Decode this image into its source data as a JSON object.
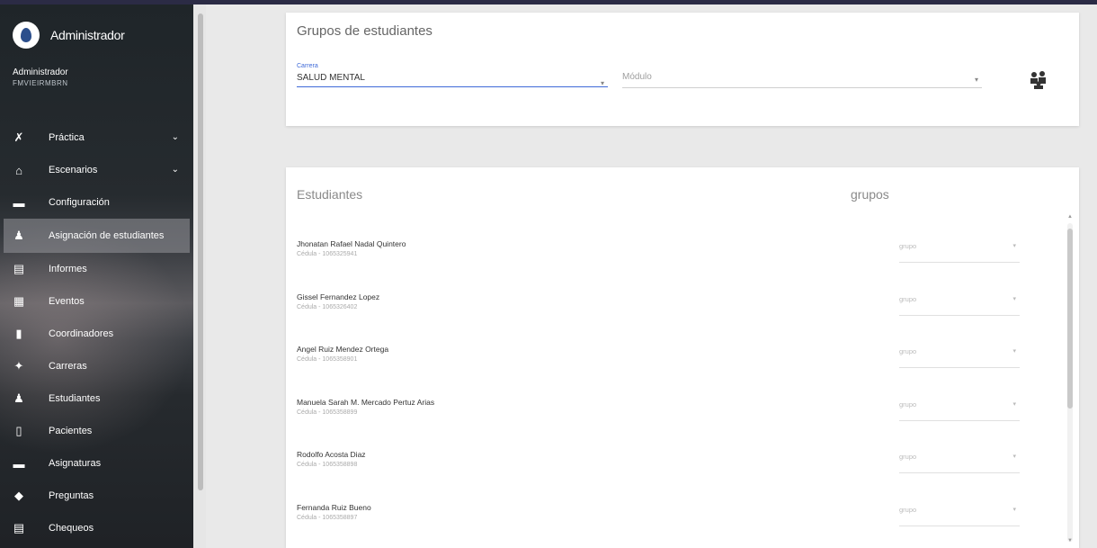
{
  "sidebar": {
    "brand": "Administrador",
    "user_name": "Administrador",
    "user_sub": "FMVIEIRMBRN",
    "items": [
      {
        "label": "Práctica",
        "icon": "practice-icon",
        "glyph": "✗",
        "caret": "⌄"
      },
      {
        "label": "Escenarios",
        "icon": "home-icon",
        "glyph": "⌂",
        "caret": "⌄"
      },
      {
        "label": "Configuración",
        "icon": "chat-icon",
        "glyph": "▬",
        "caret": ""
      },
      {
        "label": "Asignación de estudiantes",
        "icon": "person-icon",
        "glyph": "♟",
        "caret": ""
      },
      {
        "label": "Informes",
        "icon": "report-icon",
        "glyph": "▤",
        "caret": ""
      },
      {
        "label": "Eventos",
        "icon": "calendar-icon",
        "glyph": "▦",
        "caret": ""
      },
      {
        "label": "Coordinadores",
        "icon": "coordinator-icon",
        "glyph": "▮",
        "caret": ""
      },
      {
        "label": "Carreras",
        "icon": "career-icon",
        "glyph": "✦",
        "caret": ""
      },
      {
        "label": "Estudiantes",
        "icon": "student-icon",
        "glyph": "♟",
        "caret": ""
      },
      {
        "label": "Pacientes",
        "icon": "clipboard-icon",
        "glyph": "▯",
        "caret": ""
      },
      {
        "label": "Asignaturas",
        "icon": "subjects-icon",
        "glyph": "▬",
        "caret": ""
      },
      {
        "label": "Preguntas",
        "icon": "question-icon",
        "glyph": "◆",
        "caret": ""
      },
      {
        "label": "Chequeos",
        "icon": "checklist-icon",
        "glyph": "▤",
        "caret": ""
      }
    ]
  },
  "groups_card": {
    "title": "Grupos de estudiantes",
    "career_label": "Carrera",
    "career_value": "SALUD MENTAL",
    "module_placeholder": "Módulo",
    "caret": "▾",
    "assign_icon": "group-assign-icon"
  },
  "students_card": {
    "col_students": "Estudiantes",
    "col_groups": "grupos",
    "group_placeholder": "grupo",
    "caret": "▾",
    "students": [
      {
        "name": "Jhonatan Rafael Nadal Quintero",
        "sub": "Cédula - 1065325941"
      },
      {
        "name": "Gissel Fernandez Lopez",
        "sub": "Cédula - 1065326402"
      },
      {
        "name": "Angel Ruiz Mendez Ortega",
        "sub": "Cédula - 1065358901"
      },
      {
        "name": "Manuela Sarah M. Mercado Pertuz Arias",
        "sub": "Cédula - 1065358899"
      },
      {
        "name": "Rodolfo Acosta Diaz",
        "sub": "Cédula - 1065358898"
      },
      {
        "name": "Fernanda Ruiz Bueno",
        "sub": "Cédula - 1065358897"
      }
    ]
  }
}
